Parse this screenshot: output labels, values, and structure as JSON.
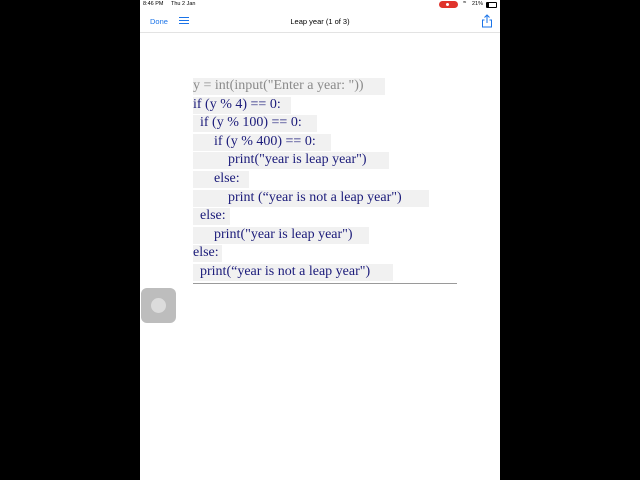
{
  "status": {
    "time": "8:46 PM",
    "date": "Thu 2 Jan",
    "battery": "21%",
    "battery_level": 0.21,
    "recording_color": "#e0342c"
  },
  "nav": {
    "done_label": "Done",
    "title": "Leap year (1 of 3)",
    "accent": "#1a73e8",
    "icons": [
      "list-icon",
      "share-icon"
    ]
  },
  "code": {
    "lines": [
      "y = int(input(\"Enter a year: \"))",
      "if (y % 4) == 0:",
      "  if (y % 100) == 0:",
      "      if (y % 400) == 0:",
      "          print(\"year is leap year\")",
      "      else:",
      "          print (“year is not a leap year\")",
      "  else:",
      "      print(\"year is leap year\")",
      "else:",
      "  print(“year is not a leap year\")"
    ]
  }
}
